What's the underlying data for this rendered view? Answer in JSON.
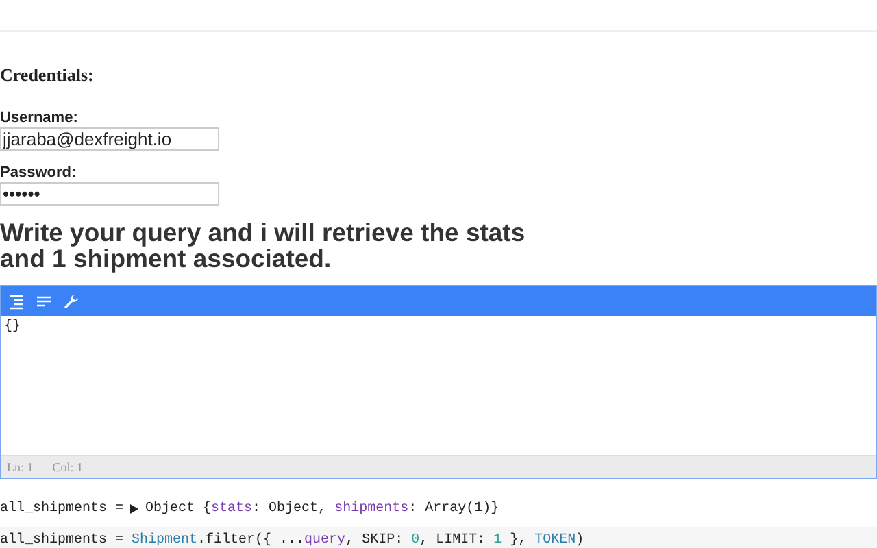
{
  "credentials": {
    "title": "Credentials:",
    "fields": [
      {
        "label": "Username:",
        "value": "jjaraba@dexfreight.io"
      },
      {
        "label": "Password:",
        "value": "••••••"
      }
    ]
  },
  "heading": "Write your query and i will retrieve the stats and 1 shipment associated.",
  "editor": {
    "content": "{}",
    "status": [
      "Ln: 1",
      "Col: 1"
    ]
  },
  "output": {
    "variable": "all_shipments =",
    "expanded": false,
    "tokens": [
      {
        "kind": "plain",
        "text": "Object {"
      },
      {
        "kind": "prop",
        "text": "stats"
      },
      {
        "kind": "plain",
        "text": ": Object, "
      },
      {
        "kind": "prop",
        "text": "shipments"
      },
      {
        "kind": "plain",
        "text": ": Array(1)}"
      }
    ]
  },
  "code": {
    "tokens": [
      {
        "kind": "plain",
        "text": "all_shipments = "
      },
      {
        "kind": "class",
        "text": "Shipment"
      },
      {
        "kind": "plain",
        "text": ".filter({ ..."
      },
      {
        "kind": "prop",
        "text": "query"
      },
      {
        "kind": "plain",
        "text": ", SKIP: "
      },
      {
        "kind": "number",
        "text": "0"
      },
      {
        "kind": "plain",
        "text": ", LIMIT: "
      },
      {
        "kind": "number",
        "text": "1"
      },
      {
        "kind": "plain",
        "text": " }, "
      },
      {
        "kind": "class",
        "text": "TOKEN"
      },
      {
        "kind": "plain",
        "text": ")"
      }
    ]
  }
}
